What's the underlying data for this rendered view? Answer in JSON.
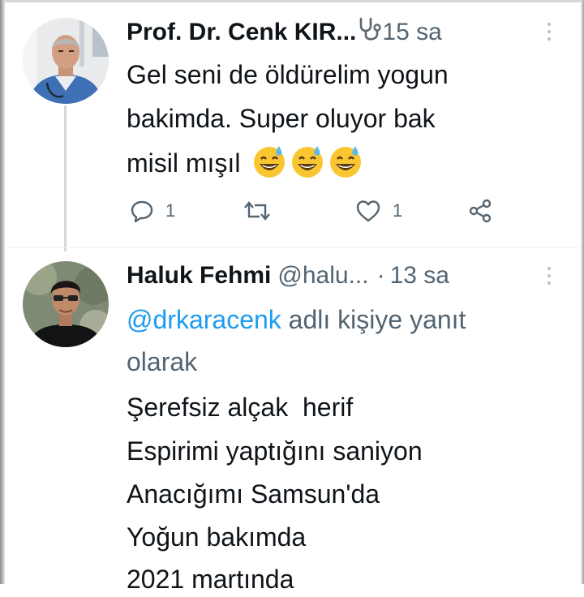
{
  "tweet1": {
    "author_name": "Prof. Dr. Cenk KIR...",
    "time": "15 sa",
    "text_lines": [
      "Gel seni de öldürelim yogun",
      "bakimda. Super oluyor bak",
      "misil mışıl"
    ],
    "emojis": [
      "grinning-face-with-sweat",
      "grinning-face-with-sweat",
      "grinning-face-with-sweat"
    ],
    "actions": {
      "reply_count": "1",
      "retweet_count": "",
      "like_count": "1"
    },
    "badge_icon": "stethoscope-icon"
  },
  "tweet2": {
    "author_name": "Haluk Fehmi",
    "handle": "@halu...",
    "separator": "·",
    "time": "13 sa",
    "reply_to": {
      "mention": "@drkaracenk",
      "suffix": " adlı kişiye yanıt",
      "line2": "olarak"
    },
    "text_lines": [
      "Şerefsiz alçak  herif",
      "Espirimi yaptığını saniyon",
      "Anacığımı Samsun'da",
      "Yoğun bakımda",
      "2021 martında"
    ]
  },
  "colors": {
    "text": "#0f1419",
    "muted": "#536471",
    "link": "#1d9bf0",
    "thread_line": "#cfd9de"
  }
}
